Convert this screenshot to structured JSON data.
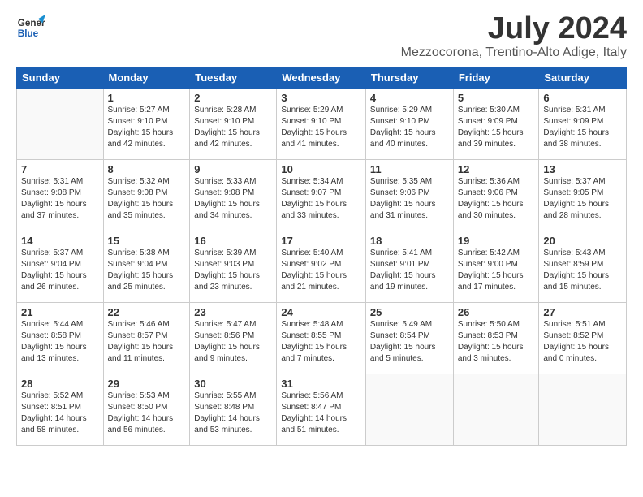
{
  "logo": {
    "line1": "General",
    "line2": "Blue"
  },
  "title": "July 2024",
  "location": "Mezzocorona, Trentino-Alto Adige, Italy",
  "headers": [
    "Sunday",
    "Monday",
    "Tuesday",
    "Wednesday",
    "Thursday",
    "Friday",
    "Saturday"
  ],
  "weeks": [
    [
      {
        "day": "",
        "info": ""
      },
      {
        "day": "1",
        "info": "Sunrise: 5:27 AM\nSunset: 9:10 PM\nDaylight: 15 hours\nand 42 minutes."
      },
      {
        "day": "2",
        "info": "Sunrise: 5:28 AM\nSunset: 9:10 PM\nDaylight: 15 hours\nand 42 minutes."
      },
      {
        "day": "3",
        "info": "Sunrise: 5:29 AM\nSunset: 9:10 PM\nDaylight: 15 hours\nand 41 minutes."
      },
      {
        "day": "4",
        "info": "Sunrise: 5:29 AM\nSunset: 9:10 PM\nDaylight: 15 hours\nand 40 minutes."
      },
      {
        "day": "5",
        "info": "Sunrise: 5:30 AM\nSunset: 9:09 PM\nDaylight: 15 hours\nand 39 minutes."
      },
      {
        "day": "6",
        "info": "Sunrise: 5:31 AM\nSunset: 9:09 PM\nDaylight: 15 hours\nand 38 minutes."
      }
    ],
    [
      {
        "day": "7",
        "info": "Sunrise: 5:31 AM\nSunset: 9:08 PM\nDaylight: 15 hours\nand 37 minutes."
      },
      {
        "day": "8",
        "info": "Sunrise: 5:32 AM\nSunset: 9:08 PM\nDaylight: 15 hours\nand 35 minutes."
      },
      {
        "day": "9",
        "info": "Sunrise: 5:33 AM\nSunset: 9:08 PM\nDaylight: 15 hours\nand 34 minutes."
      },
      {
        "day": "10",
        "info": "Sunrise: 5:34 AM\nSunset: 9:07 PM\nDaylight: 15 hours\nand 33 minutes."
      },
      {
        "day": "11",
        "info": "Sunrise: 5:35 AM\nSunset: 9:06 PM\nDaylight: 15 hours\nand 31 minutes."
      },
      {
        "day": "12",
        "info": "Sunrise: 5:36 AM\nSunset: 9:06 PM\nDaylight: 15 hours\nand 30 minutes."
      },
      {
        "day": "13",
        "info": "Sunrise: 5:37 AM\nSunset: 9:05 PM\nDaylight: 15 hours\nand 28 minutes."
      }
    ],
    [
      {
        "day": "14",
        "info": "Sunrise: 5:37 AM\nSunset: 9:04 PM\nDaylight: 15 hours\nand 26 minutes."
      },
      {
        "day": "15",
        "info": "Sunrise: 5:38 AM\nSunset: 9:04 PM\nDaylight: 15 hours\nand 25 minutes."
      },
      {
        "day": "16",
        "info": "Sunrise: 5:39 AM\nSunset: 9:03 PM\nDaylight: 15 hours\nand 23 minutes."
      },
      {
        "day": "17",
        "info": "Sunrise: 5:40 AM\nSunset: 9:02 PM\nDaylight: 15 hours\nand 21 minutes."
      },
      {
        "day": "18",
        "info": "Sunrise: 5:41 AM\nSunset: 9:01 PM\nDaylight: 15 hours\nand 19 minutes."
      },
      {
        "day": "19",
        "info": "Sunrise: 5:42 AM\nSunset: 9:00 PM\nDaylight: 15 hours\nand 17 minutes."
      },
      {
        "day": "20",
        "info": "Sunrise: 5:43 AM\nSunset: 8:59 PM\nDaylight: 15 hours\nand 15 minutes."
      }
    ],
    [
      {
        "day": "21",
        "info": "Sunrise: 5:44 AM\nSunset: 8:58 PM\nDaylight: 15 hours\nand 13 minutes."
      },
      {
        "day": "22",
        "info": "Sunrise: 5:46 AM\nSunset: 8:57 PM\nDaylight: 15 hours\nand 11 minutes."
      },
      {
        "day": "23",
        "info": "Sunrise: 5:47 AM\nSunset: 8:56 PM\nDaylight: 15 hours\nand 9 minutes."
      },
      {
        "day": "24",
        "info": "Sunrise: 5:48 AM\nSunset: 8:55 PM\nDaylight: 15 hours\nand 7 minutes."
      },
      {
        "day": "25",
        "info": "Sunrise: 5:49 AM\nSunset: 8:54 PM\nDaylight: 15 hours\nand 5 minutes."
      },
      {
        "day": "26",
        "info": "Sunrise: 5:50 AM\nSunset: 8:53 PM\nDaylight: 15 hours\nand 3 minutes."
      },
      {
        "day": "27",
        "info": "Sunrise: 5:51 AM\nSunset: 8:52 PM\nDaylight: 15 hours\nand 0 minutes."
      }
    ],
    [
      {
        "day": "28",
        "info": "Sunrise: 5:52 AM\nSunset: 8:51 PM\nDaylight: 14 hours\nand 58 minutes."
      },
      {
        "day": "29",
        "info": "Sunrise: 5:53 AM\nSunset: 8:50 PM\nDaylight: 14 hours\nand 56 minutes."
      },
      {
        "day": "30",
        "info": "Sunrise: 5:55 AM\nSunset: 8:48 PM\nDaylight: 14 hours\nand 53 minutes."
      },
      {
        "day": "31",
        "info": "Sunrise: 5:56 AM\nSunset: 8:47 PM\nDaylight: 14 hours\nand 51 minutes."
      },
      {
        "day": "",
        "info": ""
      },
      {
        "day": "",
        "info": ""
      },
      {
        "day": "",
        "info": ""
      }
    ]
  ]
}
